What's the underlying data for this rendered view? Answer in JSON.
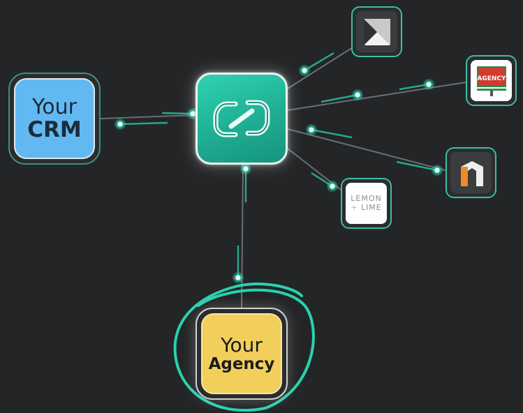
{
  "nodes": {
    "crm": {
      "line1": "Your",
      "line2": "CRM"
    },
    "agency": {
      "line1": "Your",
      "line2": "Agency"
    },
    "partners": [
      {
        "name": "agency-partner-logo",
        "text": "AGENCY"
      },
      {
        "name": "lemon-lime-logo",
        "line1": "LEMON",
        "plus": "+",
        "line2": "LIME"
      }
    ]
  },
  "colors": {
    "background": "#232527",
    "accent": "#2ad1b0",
    "crm": "#62b9f2",
    "agency": "#f2cf5b",
    "hub": "#22b99b"
  },
  "icons": [
    "hub-sync-icon",
    "envelope-icon",
    "house-r-icon"
  ]
}
